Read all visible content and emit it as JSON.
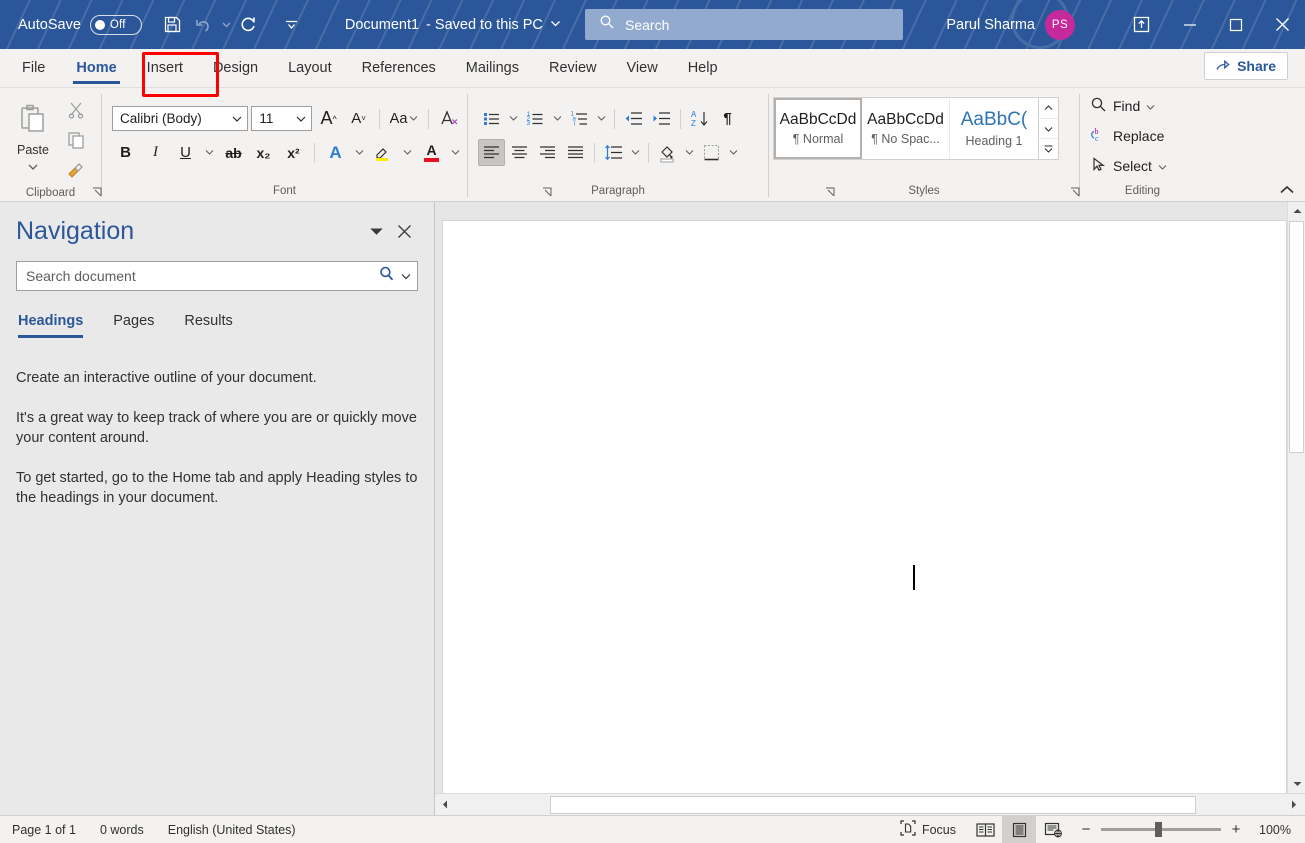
{
  "titlebar": {
    "autosave_label": "AutoSave",
    "autosave_state": "Off",
    "document_title": "Document1",
    "save_state": "-  Saved to this PC",
    "quick_access": [
      {
        "name": "save-icon",
        "label": "Save"
      },
      {
        "name": "undo-icon",
        "label": "Undo"
      },
      {
        "name": "redo-icon",
        "label": "Redo"
      },
      {
        "name": "customize-qat-icon",
        "label": "Customize Quick Access Toolbar"
      }
    ],
    "search_placeholder": "Search",
    "user_name": "Parul Sharma",
    "user_initials": "PS",
    "ribbon_display_options": "Ribbon Display Options",
    "minimize": "Minimize",
    "restore": "Restore Down",
    "close": "Close",
    "bg_color": "#2b579a",
    "avatar_color": "#c5299b"
  },
  "tabs": [
    {
      "label": "File",
      "active": false
    },
    {
      "label": "Home",
      "active": true
    },
    {
      "label": "Insert",
      "active": false,
      "highlighted": true
    },
    {
      "label": "Design",
      "active": false
    },
    {
      "label": "Layout",
      "active": false
    },
    {
      "label": "References",
      "active": false
    },
    {
      "label": "Mailings",
      "active": false
    },
    {
      "label": "Review",
      "active": false
    },
    {
      "label": "View",
      "active": false
    },
    {
      "label": "Help",
      "active": false
    }
  ],
  "highlight": {
    "target": "Insert",
    "color": "#ff0000"
  },
  "share": {
    "label": "Share"
  },
  "ribbon": {
    "clipboard": {
      "group_label": "Clipboard",
      "paste_label": "Paste",
      "cut_label": "Cut",
      "copy_label": "Copy",
      "format_painter_label": "Format Painter"
    },
    "font": {
      "group_label": "Font",
      "font_name": "Calibri (Body)",
      "font_size": "11",
      "grow_font": "A",
      "shrink_font": "A",
      "change_case": "Aa",
      "clear_formatting": "Clear All Formatting",
      "bold": "B",
      "italic": "I",
      "underline": "U",
      "strikethrough": "ab",
      "subscript": "x₂",
      "superscript": "x²",
      "text_effects": "A",
      "highlight": "Text Highlight Color",
      "font_color": "A"
    },
    "paragraph": {
      "group_label": "Paragraph",
      "bullets": "Bullets",
      "numbering": "Numbering",
      "multilevel": "Multilevel List",
      "decrease_indent": "Decrease Indent",
      "increase_indent": "Increase Indent",
      "sort": "Sort",
      "show_marks": "¶",
      "align_left": "Align Left",
      "center": "Center",
      "align_right": "Align Right",
      "justify": "Justify",
      "line_spacing": "Line and Paragraph Spacing",
      "shading": "Shading",
      "borders": "Borders"
    },
    "styles": {
      "group_label": "Styles",
      "items": [
        {
          "sample": "AaBbCcDd",
          "name": "¶ Normal",
          "selected": true
        },
        {
          "sample": "AaBbCcDd",
          "name": "¶ No Spac...",
          "selected": false
        },
        {
          "sample": "AaBbC(",
          "name": "Heading 1",
          "selected": false
        }
      ]
    },
    "editing": {
      "group_label": "Editing",
      "find": "Find",
      "replace": "Replace",
      "select": "Select"
    },
    "collapse_label": "Collapse the Ribbon"
  },
  "navigation": {
    "title": "Navigation",
    "search_placeholder": "Search document",
    "tabs": [
      {
        "label": "Headings",
        "active": true
      },
      {
        "label": "Pages",
        "active": false
      },
      {
        "label": "Results",
        "active": false
      }
    ],
    "paragraphs": [
      "Create an interactive outline of your document.",
      "It's a great way to keep track of where you are or quickly move your content around.",
      "To get started, go to the Home tab and apply Heading styles to the headings in your document."
    ],
    "dropdown_label": "Task Pane Options",
    "close_label": "Close"
  },
  "statusbar": {
    "page": "Page 1 of 1",
    "words": "0 words",
    "language": "English (United States)",
    "focus": "Focus",
    "read_mode": "Read Mode",
    "print_layout": "Print Layout",
    "web_layout": "Web Layout",
    "zoom_out": "−",
    "zoom_in": "+",
    "zoom_level": "100%"
  }
}
